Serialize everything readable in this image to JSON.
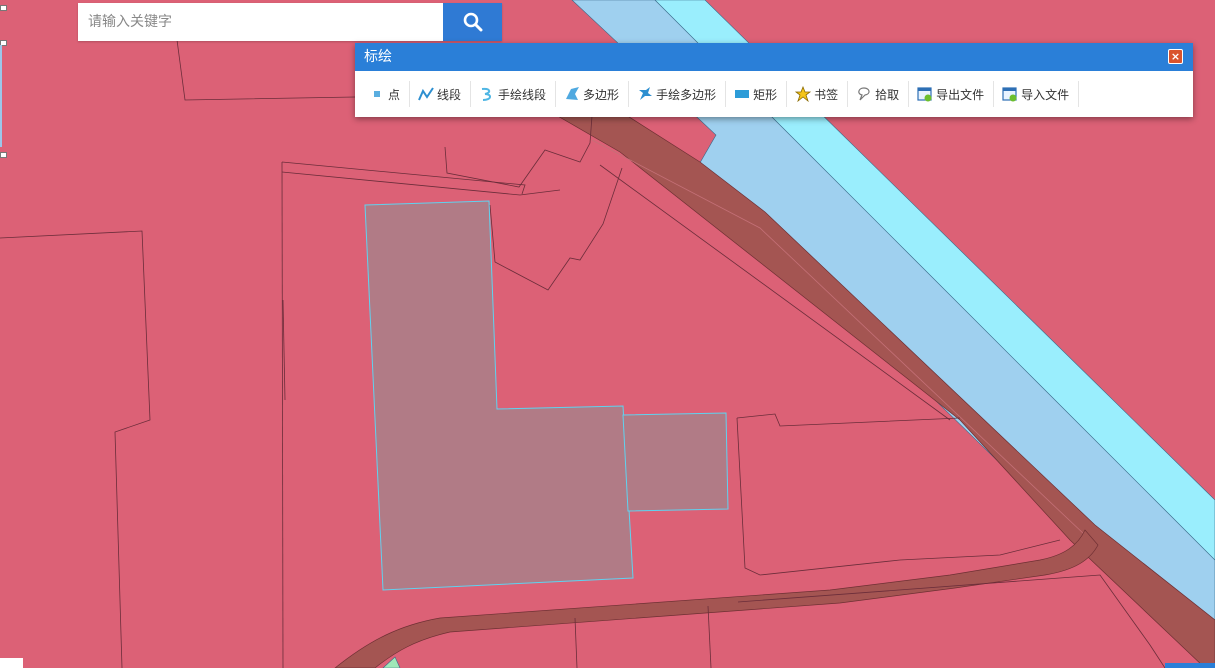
{
  "search": {
    "placeholder": "请输入关键字"
  },
  "panel": {
    "title": "标绘",
    "tools": [
      {
        "label": "点",
        "icon": "point-icon"
      },
      {
        "label": "线段",
        "icon": "polyline-icon"
      },
      {
        "label": "手绘线段",
        "icon": "freehand-line-icon"
      },
      {
        "label": "多边形",
        "icon": "polygon-icon"
      },
      {
        "label": "手绘多边形",
        "icon": "freehand-polygon-icon"
      },
      {
        "label": "矩形",
        "icon": "rectangle-icon"
      },
      {
        "label": "书签",
        "icon": "star-icon"
      },
      {
        "label": "拾取",
        "icon": "pick-icon"
      },
      {
        "label": "导出文件",
        "icon": "export-file-icon"
      },
      {
        "label": "导入文件",
        "icon": "import-file-icon"
      }
    ]
  },
  "colors": {
    "land": "#dc6176",
    "road": "#a45552",
    "river_light": "#9fd0ef",
    "river_cyan": "#9aeefd",
    "selection": "#b17b86",
    "selection_border": "#5fd3f0",
    "accent": "#2a7fd8"
  }
}
